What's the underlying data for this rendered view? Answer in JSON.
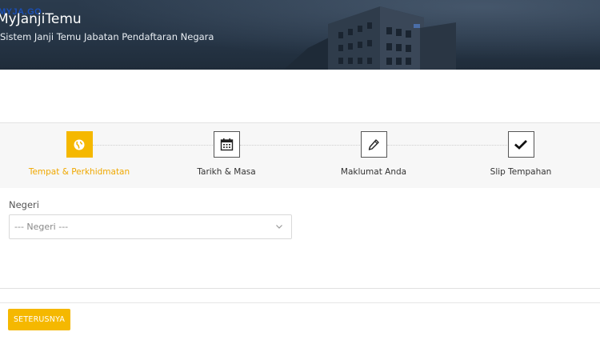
{
  "header": {
    "logo_text": "MYJA.GO",
    "title": "MyJanjiTemu",
    "subtitle": "Sistem Janji Temu Jabatan Pendaftaran Negara"
  },
  "stepper": {
    "steps": [
      {
        "label": "Tempat & Perkhidmatan",
        "icon": "globe-icon",
        "active": true
      },
      {
        "label": "Tarikh & Masa",
        "icon": "calendar-icon",
        "active": false
      },
      {
        "label": "Maklumat Anda",
        "icon": "pencil-icon",
        "active": false
      },
      {
        "label": "Slip Tempahan",
        "icon": "check-icon",
        "active": false
      }
    ]
  },
  "form": {
    "negeri_label": "Negeri",
    "negeri_value": "--- Negeri ---"
  },
  "actions": {
    "next_label": "SETERUSNYA"
  },
  "colors": {
    "accent": "#f5b800",
    "banner": "#263546"
  }
}
